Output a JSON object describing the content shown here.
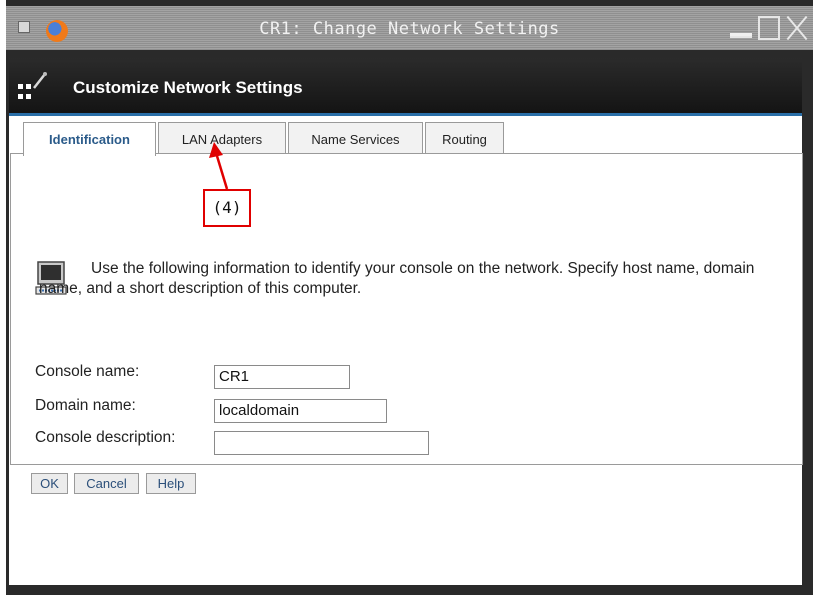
{
  "window": {
    "title": "CR1: Change Network Settings"
  },
  "banner": {
    "title": "Customize Network Settings"
  },
  "tabs": [
    {
      "label": "Identification",
      "selected": true
    },
    {
      "label": "LAN Adapters",
      "selected": false
    },
    {
      "label": "Name Services",
      "selected": false
    },
    {
      "label": "Routing",
      "selected": false
    }
  ],
  "annotation": {
    "label": "(4)",
    "color": "#e00000"
  },
  "description": "Use the following information to identify your console on the network. Specify host name, domain name, and a short description of this computer.",
  "form": {
    "console_name": {
      "label": "Console name:",
      "value": "CR1"
    },
    "domain_name": {
      "label": "Domain name:",
      "value": "localdomain"
    },
    "console_description": {
      "label": "Console description:",
      "value": ""
    }
  },
  "buttons": {
    "ok": "OK",
    "cancel": "Cancel",
    "help": "Help"
  },
  "colors": {
    "accent": "#2a6fa8",
    "active_tab_text": "#2b5b8a",
    "banner_bg": "#1c1c1c"
  },
  "icons": {
    "system_menu": "system-menu-icon",
    "browser": "firefox-icon",
    "banner": "network-settings-icon",
    "console": "console-computer-icon"
  }
}
